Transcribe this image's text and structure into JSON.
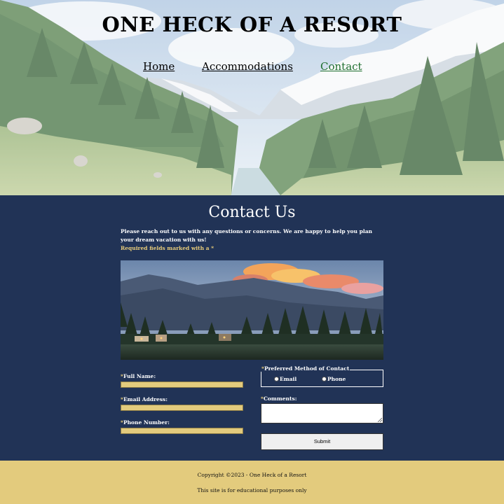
{
  "header": {
    "title": "ONE HECK OF A RESORT",
    "nav": [
      {
        "label": "Home",
        "active": false
      },
      {
        "label": "Accommodations",
        "active": false
      },
      {
        "label": "Contact",
        "active": true
      }
    ]
  },
  "main": {
    "heading": "Contact Us",
    "intro": "Please reach out to us with any questions or concerns. We are happy to help you plan your dream vacation with us!",
    "required_note": "Required fields marked with a *",
    "form": {
      "full_name_label": "Full Name:",
      "email_label": "Email Address:",
      "phone_label": "Phone Number:",
      "contact_method_legend": "Preferred Method of Contact",
      "contact_options": [
        "Email",
        "Phone"
      ],
      "comments_label": "Comments:",
      "submit_label": "Submit",
      "required_marker": "*"
    }
  },
  "footer": {
    "copyright": "Copyright ©2023 - One Heck of a Resort",
    "note": "This site is for educational purposes only"
  },
  "colors": {
    "navy": "#213356",
    "gold": "#e3cb7d",
    "active_link": "#1e6e2e"
  }
}
